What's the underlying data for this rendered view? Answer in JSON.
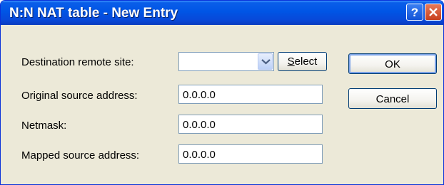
{
  "window": {
    "title": "N:N NAT table - New Entry",
    "help_icon": "help-icon",
    "close_icon": "close-icon"
  },
  "form": {
    "destination": {
      "label": "Destination remote site:",
      "value": ""
    },
    "original_source": {
      "label": "Original source address:",
      "value": "0.0.0.0"
    },
    "netmask": {
      "label": "Netmask:",
      "value": "0.0.0.0"
    },
    "mapped_source": {
      "label": "Mapped source address:",
      "value": "0.0.0.0"
    }
  },
  "buttons": {
    "select_first": "S",
    "select_rest": "elect",
    "ok": "OK",
    "cancel": "Cancel"
  },
  "colors": {
    "titlebar": "#0055e5",
    "dialog_bg": "#ece9d8",
    "field_border": "#7f9db9"
  }
}
